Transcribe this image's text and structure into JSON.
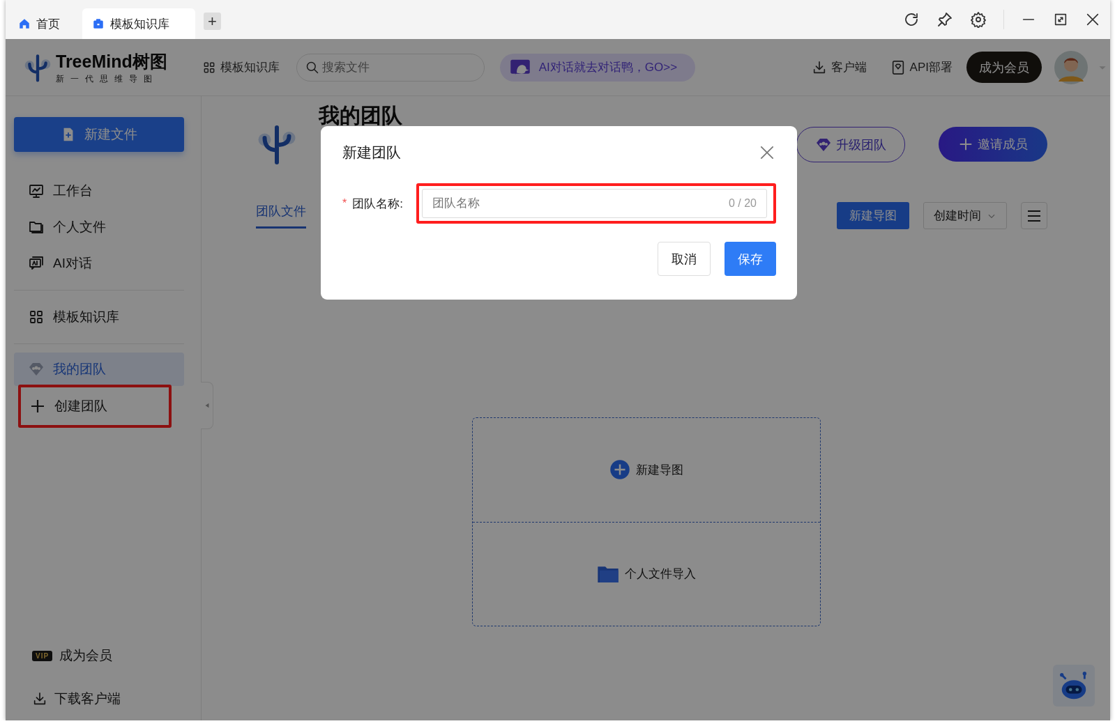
{
  "title_bar": {
    "tabs": [
      {
        "label": "首页",
        "kind": "home",
        "selected": false
      },
      {
        "label": "模板知识库",
        "kind": "library",
        "selected": true
      }
    ],
    "new_tab": "+"
  },
  "header": {
    "logo": {
      "name": "TreeMind树图",
      "tagline": "新一代思维导图"
    },
    "nav_link": "模板知识库",
    "search": {
      "placeholder": "搜索文件"
    },
    "promo": "AI对话就去对话鸭，GO>>",
    "client": "客户端",
    "api": "API部署",
    "member_button": "成为会员"
  },
  "sidebar": {
    "new_file": "新建文件",
    "groups": [
      [
        {
          "label": "工作台",
          "kind": "monitor",
          "selected": false,
          "highlighted": false
        },
        {
          "label": "个人文件",
          "kind": "folder",
          "selected": false,
          "highlighted": false
        },
        {
          "label": "AI对话",
          "kind": "ai",
          "selected": false,
          "highlighted": false
        }
      ],
      [
        {
          "label": "模板知识库",
          "kind": "grid",
          "selected": false,
          "highlighted": false
        }
      ],
      [
        {
          "label": "我的团队",
          "kind": "team",
          "selected": true,
          "highlighted": false
        },
        {
          "label": "创建团队",
          "kind": "plus",
          "selected": false,
          "highlighted": true
        }
      ]
    ],
    "footer": [
      {
        "label": "成为会员",
        "kind": "vip",
        "badge": "VIP"
      },
      {
        "label": "下载客户端",
        "kind": "download"
      }
    ]
  },
  "main": {
    "title": "我的团队",
    "upgrade_button": "升级团队",
    "invite_button": "邀请成员",
    "tabs": [
      {
        "label": "团队文件",
        "selected": true
      }
    ],
    "new_map_button": "新建导图",
    "sort": "创建时间",
    "empty_actions": [
      {
        "label": "新建导图",
        "kind": "new"
      },
      {
        "label": "个人文件导入",
        "kind": "import"
      }
    ]
  },
  "modal": {
    "title": "新建团队",
    "field": {
      "required_mark": "*",
      "label": "团队名称:",
      "placeholder": "团队名称",
      "counter": "0 / 20",
      "highlighted": true
    },
    "buttons": [
      {
        "label": "取消",
        "kind": "default"
      },
      {
        "label": "保存",
        "kind": "primary"
      }
    ]
  }
}
